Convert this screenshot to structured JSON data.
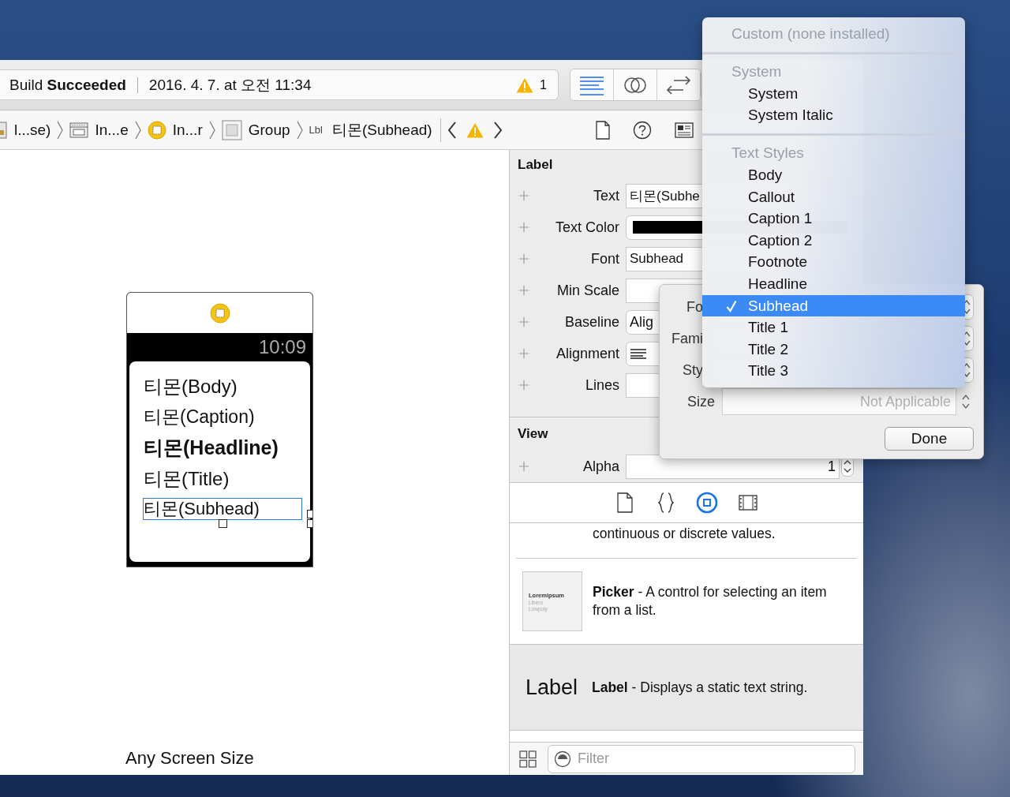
{
  "toolbar": {
    "build_status": "Build **Succeeded**",
    "timestamp": "2016. 4. 7. at 오전 11:34",
    "warning_count": "1",
    "editor_modes": [
      {
        "kind": "standard",
        "selected": true
      },
      {
        "kind": "assistant",
        "selected": false
      },
      {
        "kind": "version",
        "selected": false
      }
    ]
  },
  "jump_bar": {
    "items": [
      {
        "kind": "storyboard",
        "label": "l...se)"
      },
      {
        "kind": "scene",
        "label": "In...e"
      },
      {
        "kind": "controller",
        "label": "In...r"
      },
      {
        "kind": "group",
        "label": "Group"
      },
      {
        "kind": "label",
        "tag": "Lbl",
        "label": "티몬(Subhead)"
      }
    ]
  },
  "canvas": {
    "watch": {
      "time": "10:09",
      "labels": [
        {
          "text": "티몬(Body)",
          "kind": "body",
          "selected": false
        },
        {
          "text": "티몬(Caption)",
          "kind": "caption",
          "selected": false
        },
        {
          "text": "티몬(Headline)",
          "kind": "headline",
          "selected": false
        },
        {
          "text": "티몬(Title)",
          "kind": "title",
          "selected": false
        },
        {
          "text": "티몬(Subhead)",
          "kind": "subhead",
          "selected": true
        }
      ]
    },
    "size_class": "Any Screen Size"
  },
  "inspector": {
    "sections": [
      {
        "title": "Label",
        "rows": [
          {
            "label": "Text",
            "kind": "text",
            "value": "티몬(Subhe"
          },
          {
            "label": "Text Color",
            "kind": "color"
          },
          {
            "label": "Font",
            "kind": "text",
            "value": "Subhead"
          },
          {
            "label": "Min Scale",
            "kind": "text"
          },
          {
            "label": "Baseline",
            "kind": "popup",
            "value": "Alig"
          },
          {
            "label": "Alignment",
            "kind": "alignment"
          },
          {
            "label": "Lines",
            "kind": "text"
          }
        ]
      },
      {
        "title": "View",
        "rows": [
          {
            "label": "Alpha",
            "kind": "stepper",
            "value": "1"
          }
        ]
      }
    ]
  },
  "library": {
    "tabs": [
      {
        "kind": "file",
        "selected": false
      },
      {
        "kind": "code",
        "selected": false
      },
      {
        "kind": "object",
        "selected": true
      },
      {
        "kind": "media",
        "selected": false
      }
    ],
    "items": [
      {
        "kind": "partial",
        "text": "continuous or discrete values.",
        "selected": false
      },
      {
        "kind": "picker",
        "text": "**Picker** - A control for selecting an item from a list.",
        "thumbnail": [
          "Loremipsum",
          "Libero",
          "Lowpoly"
        ],
        "selected": false
      },
      {
        "kind": "label",
        "text": "**Label** - Displays a static text string.",
        "preview": "Label",
        "selected": true
      }
    ],
    "filter": {
      "placeholder": "Filter"
    }
  },
  "font_popover": {
    "rows": [
      {
        "label": "Fo",
        "kind": "popup"
      },
      {
        "label": "Fami",
        "kind": "popup"
      },
      {
        "label": "Sty",
        "kind": "popup"
      },
      {
        "label": "Size",
        "kind": "stepper",
        "placeholder": "Not Applicable"
      }
    ],
    "done": "Done"
  },
  "font_menu": {
    "sections": [
      {
        "header": "Custom (none installed)"
      },
      {
        "header": "System",
        "items": [
          {
            "label": "System",
            "selected": false
          },
          {
            "label": "System Italic",
            "selected": false
          }
        ]
      },
      {
        "header": "Text Styles",
        "items": [
          {
            "label": "Body",
            "selected": false
          },
          {
            "label": "Callout",
            "selected": false
          },
          {
            "label": "Caption 1",
            "selected": false
          },
          {
            "label": "Caption 2",
            "selected": false
          },
          {
            "label": "Footnote",
            "selected": false
          },
          {
            "label": "Headline",
            "selected": false
          },
          {
            "label": "Subhead",
            "selected": true
          },
          {
            "label": "Title 1",
            "selected": false
          },
          {
            "label": "Title 2",
            "selected": false
          },
          {
            "label": "Title 3",
            "selected": false
          }
        ]
      }
    ]
  }
}
